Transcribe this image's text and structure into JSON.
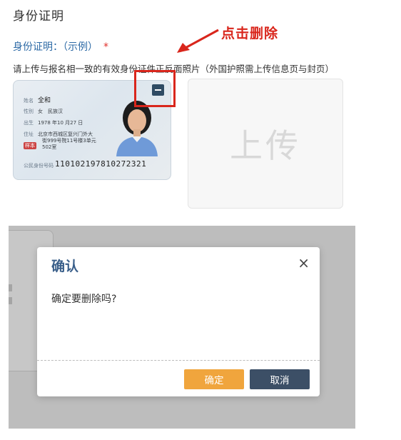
{
  "section_title": "身份证明",
  "field": {
    "label": "身份证明：（示例）",
    "required_mark": "*",
    "instruction": "请上传与报名相一致的有效身份证件正反面照片（外国护照需上传信息页与封页）"
  },
  "annotation": {
    "text": "点击删除",
    "color": "#d9261c"
  },
  "sample_card": {
    "rows": [
      {
        "label": "姓名",
        "value": "全和"
      },
      {
        "label": "性别",
        "value": "女　民族汉"
      },
      {
        "label": "出生",
        "value": "1978 年10 月27 日"
      },
      {
        "label": "住址",
        "value": "北京市西城区复兴门外大"
      },
      {
        "label": "",
        "value": "街999号院11号楼3单元"
      },
      {
        "label": "",
        "value": "502室"
      }
    ],
    "number_label": "公民身份号码",
    "number": "110102197810272321",
    "stamp": "样本"
  },
  "delete_button_icon": "minus-icon",
  "upload": {
    "label": "上传"
  },
  "dialog": {
    "title": "确认",
    "close_glyph": "×",
    "message": "确定要删除吗?",
    "confirm_label": "确定",
    "cancel_label": "取消",
    "confirm_color": "#f0a53d",
    "cancel_color": "#3c4f66",
    "title_color": "#3a5f8a"
  }
}
